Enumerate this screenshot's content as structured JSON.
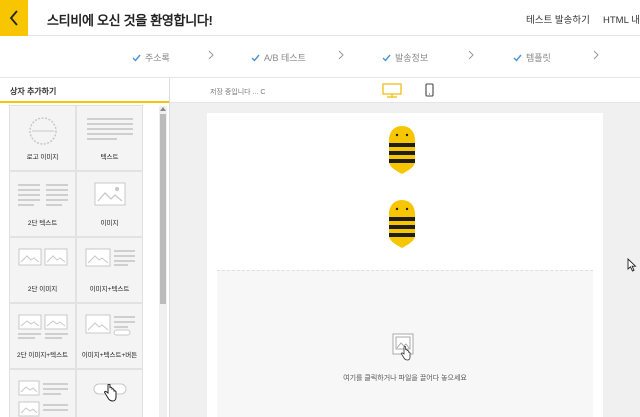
{
  "header": {
    "title": "스티비에 오신 것을 환영합니다!",
    "test_send": "테스트 발송하기",
    "html_export": "HTML 내"
  },
  "steps": [
    {
      "label": "주소록"
    },
    {
      "label": "A/B 테스트"
    },
    {
      "label": "발송정보"
    },
    {
      "label": "템플릿"
    }
  ],
  "panel": {
    "title": "상자 추가하기",
    "blocks": [
      {
        "label": "로고 이미지",
        "icon": "logo-image-icon"
      },
      {
        "label": "텍스트",
        "icon": "text-icon"
      },
      {
        "label": "2단 텍스트",
        "icon": "two-column-text-icon"
      },
      {
        "label": "이미지",
        "icon": "image-icon"
      },
      {
        "label": "2단 이미지",
        "icon": "two-column-image-icon"
      },
      {
        "label": "이미지+텍스트",
        "icon": "image-text-icon"
      },
      {
        "label": "2단 이미지+텍스트",
        "icon": "two-column-image-text-icon"
      },
      {
        "label": "이미지+텍스트+버튼",
        "icon": "image-text-button-icon"
      },
      {
        "label": "",
        "icon": "image-text-list-icon"
      },
      {
        "label": "",
        "icon": "button-icon"
      }
    ]
  },
  "toolbar": {
    "saving_status": "저장 중입니다 ...",
    "refresh_glyph": "C"
  },
  "canvas": {
    "drop_text": "여기를 클릭하거나 파일을 끌어다 놓으세요"
  },
  "colors": {
    "accent": "#f7c600",
    "check": "#4a90d9",
    "bee_stripe": "#1e1e1e"
  }
}
